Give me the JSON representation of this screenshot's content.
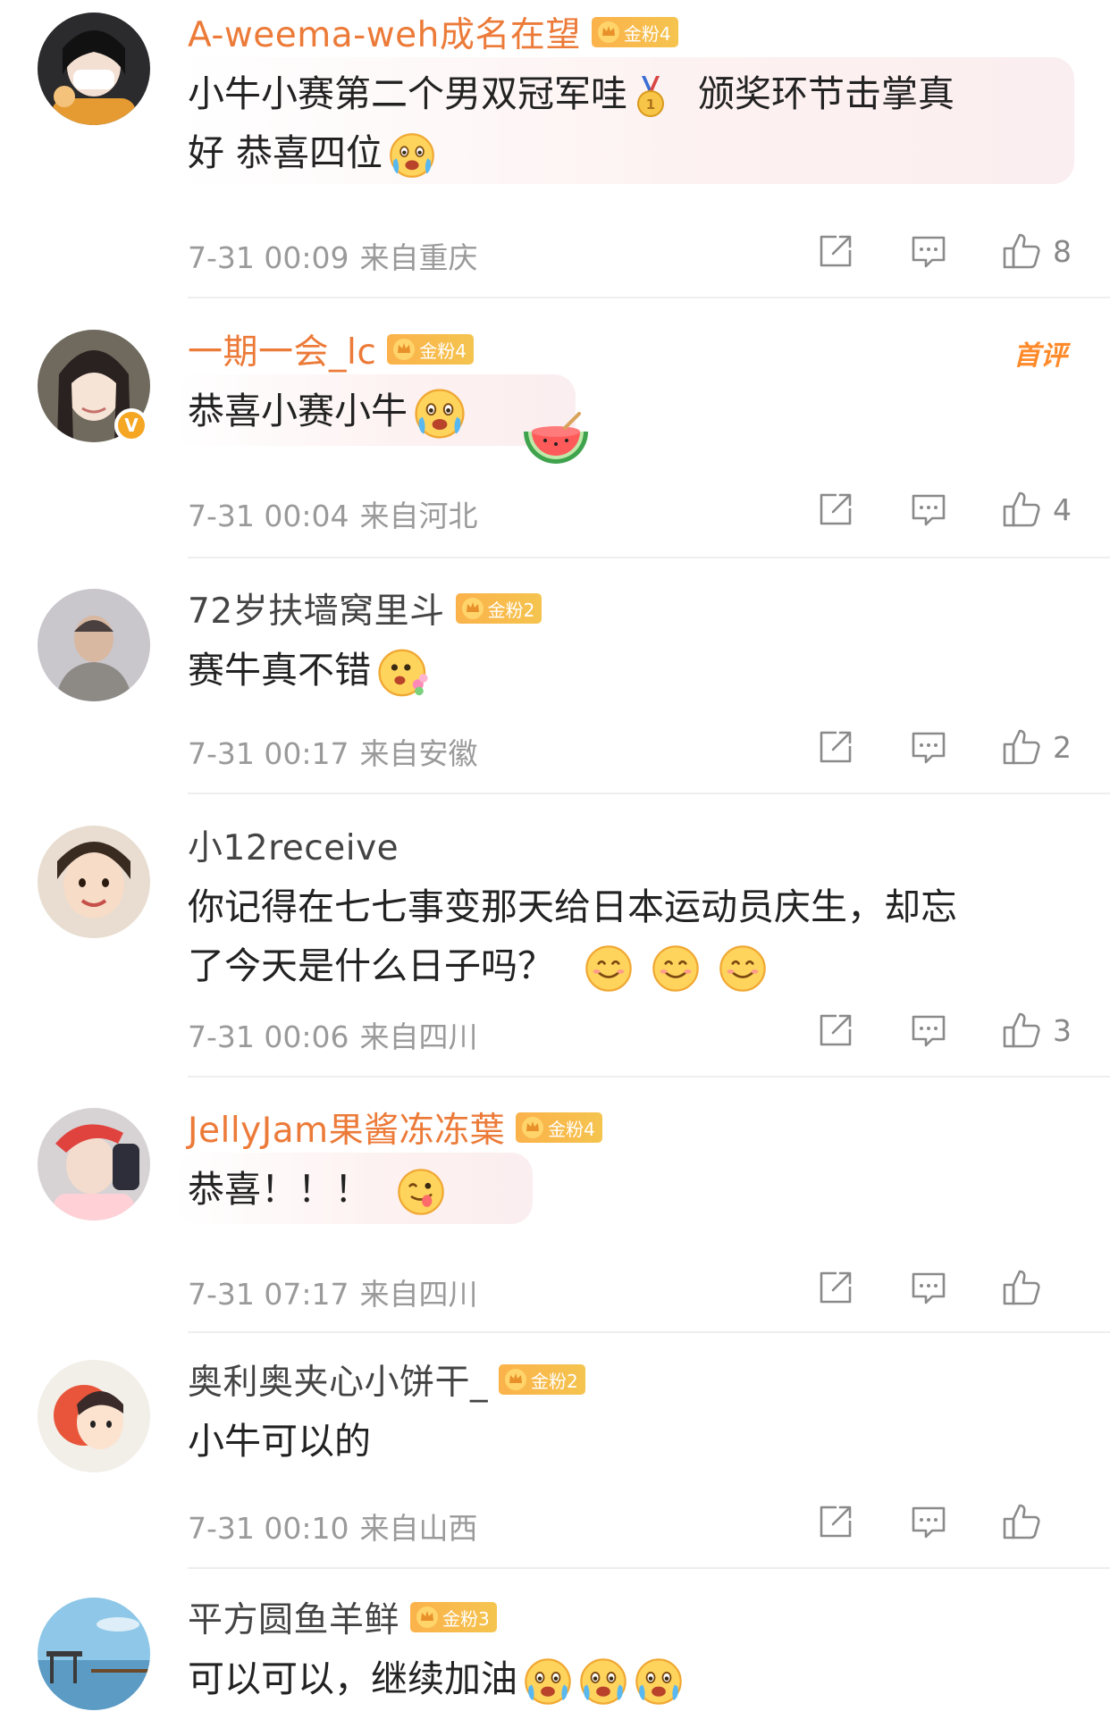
{
  "comments": [
    {
      "username": "A-weema-weh成名在望",
      "badge": "金粉4",
      "text_line1": "小牛小赛第二个男双冠军哇",
      "text_line1b": "颁奖环节击掌真",
      "text_line2": "好 恭喜四位",
      "time": "7-31 00:09",
      "location": "来自重庆",
      "likes": "8"
    },
    {
      "username": "一期一会_lc",
      "badge": "金粉4",
      "first_tag": "首评",
      "text": "恭喜小赛小牛",
      "time": "7-31 00:04",
      "location": "来自河北",
      "likes": "4"
    },
    {
      "username": "72岁扶墙窝里斗",
      "badge": "金粉2",
      "text": "赛牛真不错",
      "time": "7-31 00:17",
      "location": "来自安徽",
      "likes": "2"
    },
    {
      "username": "小12receive",
      "text_line1": "你记得在七七事变那天给日本运动员庆生，却忘",
      "text_line2": "了今天是什么日子吗？",
      "time": "7-31 00:06",
      "location": "来自四川",
      "likes": "3"
    },
    {
      "username": "JellyJam果酱冻冻葉",
      "badge": "金粉4",
      "text": "恭喜！！！",
      "time": "7-31 07:17",
      "location": "来自四川",
      "likes": ""
    },
    {
      "username": "奥利奥夹心小饼干_",
      "badge": "金粉2",
      "text": "小牛可以的",
      "time": "7-31 00:10",
      "location": "来自山西",
      "likes": ""
    },
    {
      "username": "平方圆鱼羊鲜",
      "badge": "金粉3",
      "text": "可以可以，继续加油"
    }
  ],
  "colors": {
    "username_accent": "#ec7a38",
    "badge_gold": "#f5b447",
    "meta_gray": "#9a9a9a",
    "first_tag": "#ff8a2a"
  },
  "icons": [
    "share-icon",
    "comment-icon",
    "like-icon",
    "crown-icon",
    "verified-icon",
    "medal-icon",
    "smile-emoji-icon",
    "watermelon-icon"
  ]
}
